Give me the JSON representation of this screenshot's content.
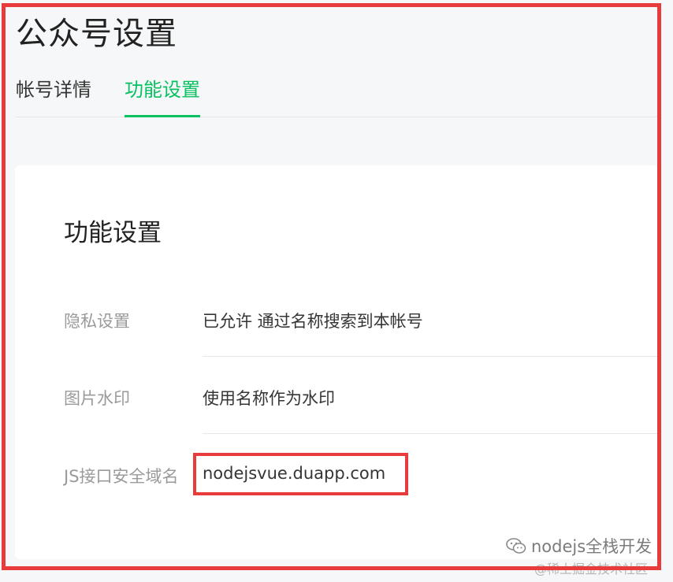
{
  "page": {
    "title": "公众号设置"
  },
  "tabs": [
    {
      "label": "帐号详情",
      "active": false
    },
    {
      "label": "功能设置",
      "active": true
    }
  ],
  "card": {
    "title": "功能设置",
    "rows": [
      {
        "label": "隐私设置",
        "value": "已允许 通过名称搜索到本帐号"
      },
      {
        "label": "图片水印",
        "value": "使用名称作为水印"
      },
      {
        "label": "JS接口安全域名",
        "value": "nodejsvue.duapp.com"
      }
    ]
  },
  "watermark": {
    "main": "nodejs全栈开发",
    "sub": "@稀土掘金技术社区"
  },
  "colors": {
    "accent": "#07c160",
    "annotation": "#e83b3b",
    "label": "#9a9a9a",
    "text": "#353535"
  }
}
